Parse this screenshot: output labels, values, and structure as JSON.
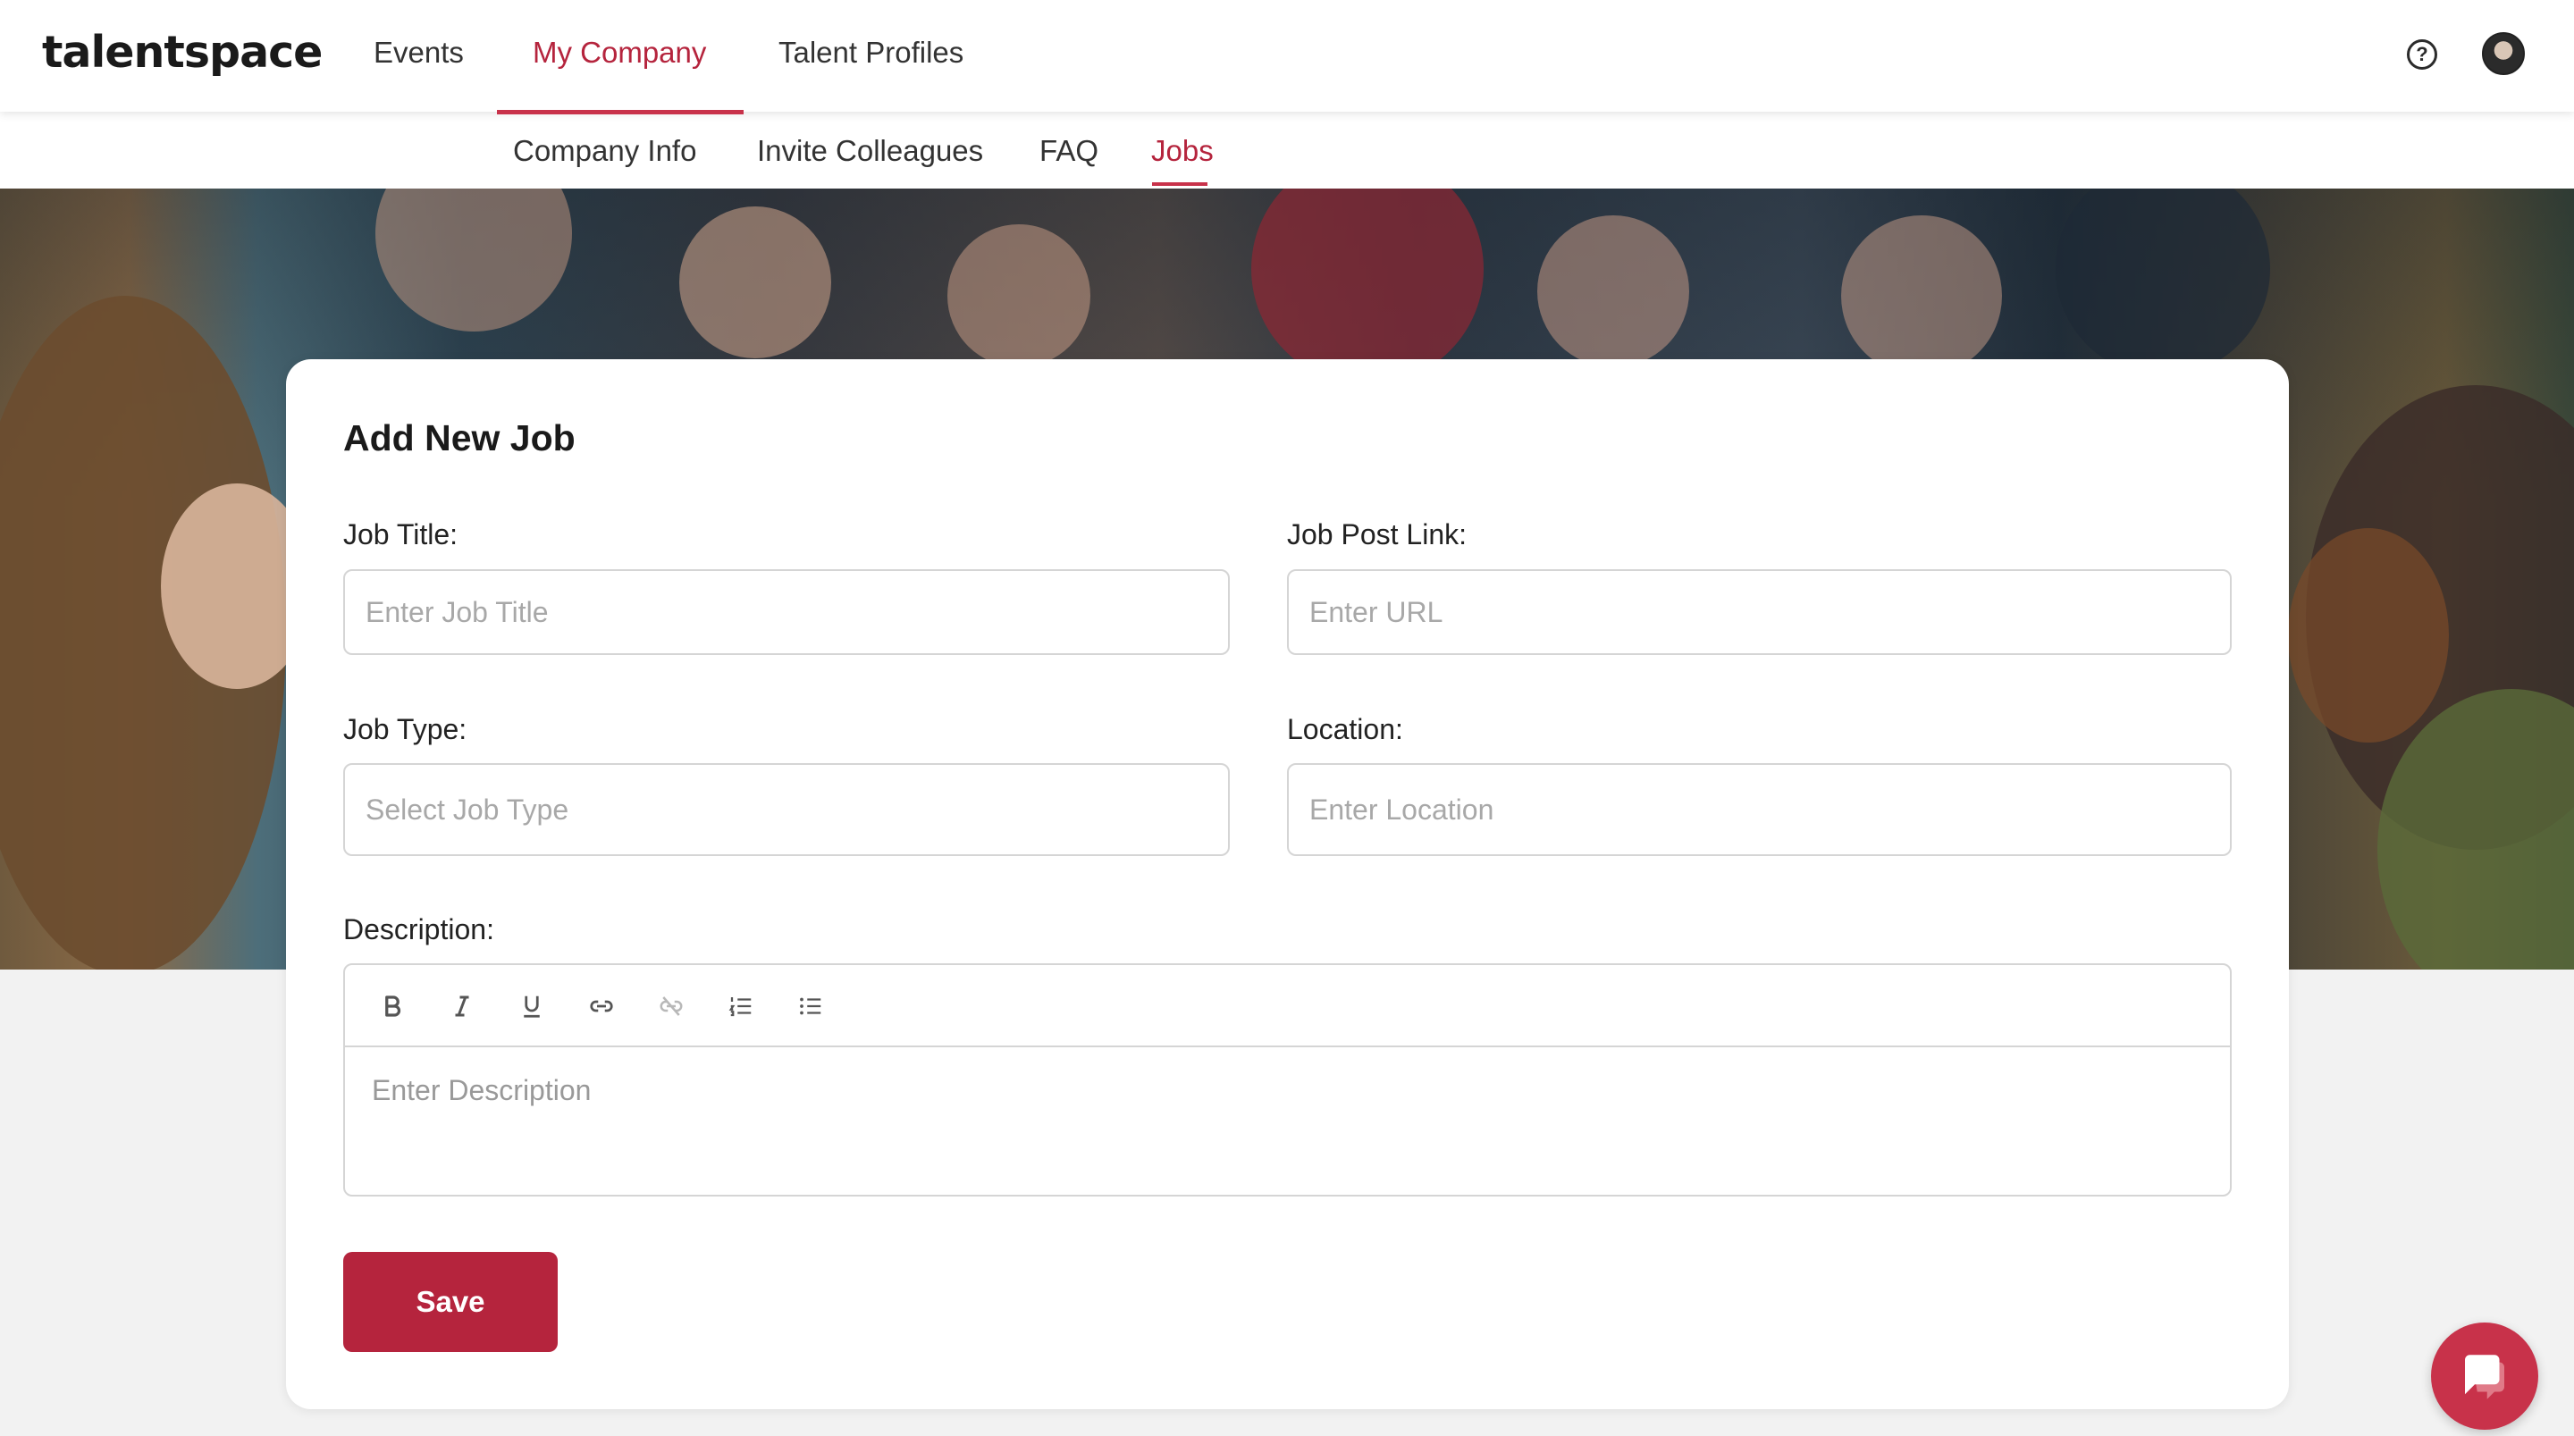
{
  "app": {
    "logo": "talentspace"
  },
  "topnav": {
    "items": [
      {
        "label": "Events"
      },
      {
        "label": "My Company",
        "active": true
      },
      {
        "label": "Talent Profiles"
      }
    ]
  },
  "subnav": {
    "items": [
      {
        "label": "Company Info"
      },
      {
        "label": "Invite Colleagues"
      },
      {
        "label": "FAQ"
      },
      {
        "label": "Jobs",
        "active": true
      }
    ]
  },
  "form": {
    "title": "Add New Job",
    "job_title": {
      "label": "Job Title:",
      "placeholder": "Enter Job Title",
      "value": ""
    },
    "job_post_link": {
      "label": "Job Post Link:",
      "placeholder": "Enter URL",
      "value": ""
    },
    "job_type": {
      "label": "Job Type:",
      "placeholder": "Select Job Type",
      "value": ""
    },
    "location": {
      "label": "Location:",
      "placeholder": "Enter Location",
      "value": ""
    },
    "description": {
      "label": "Description:",
      "placeholder": "Enter Description",
      "toolbar": [
        "bold",
        "italic",
        "underline",
        "link",
        "unlink",
        "ordered-list",
        "bullet-list"
      ]
    },
    "save_label": "Save"
  },
  "colors": {
    "accent": "#b5243d",
    "text": "#2b2b2b",
    "border": "#d5d5d5",
    "placeholder": "#a8a8a8"
  },
  "icons": {
    "help": "question-circle-icon",
    "avatar": "user-avatar",
    "chat": "chat-bubble-icon"
  }
}
